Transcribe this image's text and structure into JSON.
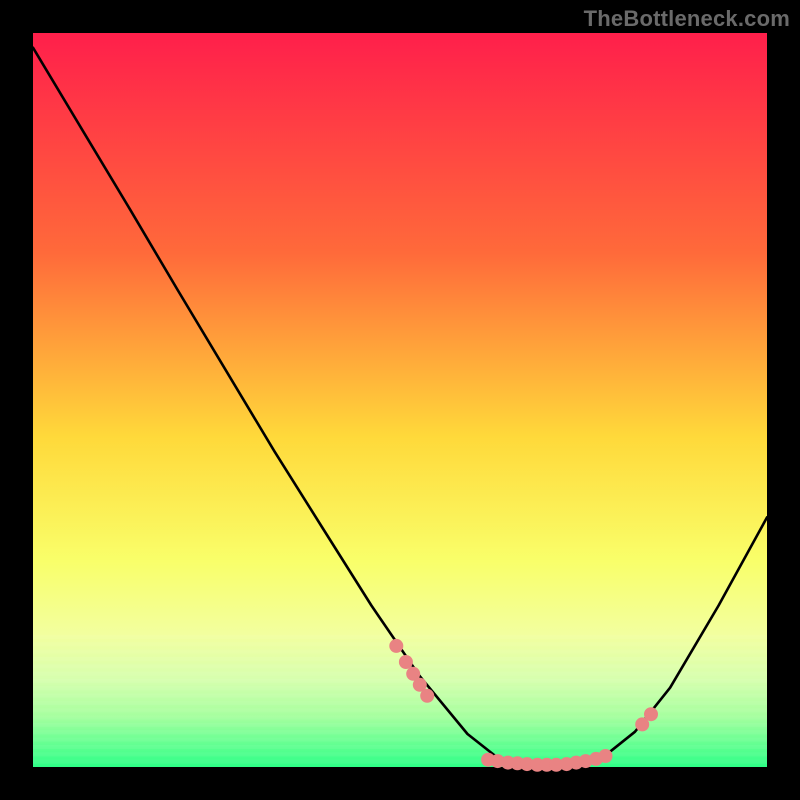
{
  "watermark": "TheBottleneck.com",
  "chart_data": {
    "type": "line",
    "title": "",
    "xlabel": "",
    "ylabel": "",
    "xlim": [
      0,
      100
    ],
    "ylim": [
      0,
      100
    ],
    "background_gradient": {
      "stops": [
        {
          "offset": 0.0,
          "color": "#ff1f4b"
        },
        {
          "offset": 0.3,
          "color": "#ff6a3a"
        },
        {
          "offset": 0.55,
          "color": "#ffd93a"
        },
        {
          "offset": 0.72,
          "color": "#f9ff6a"
        },
        {
          "offset": 0.82,
          "color": "#f2ff9f"
        },
        {
          "offset": 0.88,
          "color": "#d7ffae"
        },
        {
          "offset": 0.93,
          "color": "#a7ff9f"
        },
        {
          "offset": 1.0,
          "color": "#2eff87"
        }
      ]
    },
    "series": [
      {
        "name": "bottleneck-curve",
        "x": [
          0.0,
          6.6,
          13.2,
          19.7,
          26.3,
          32.9,
          39.5,
          46.1,
          52.6,
          59.2,
          63.0,
          66.0,
          70.0,
          74.0,
          78.0,
          82.0,
          86.8,
          93.4,
          100.0
        ],
        "y": [
          98.0,
          87.0,
          76.0,
          65.0,
          54.0,
          43.0,
          32.5,
          22.0,
          12.5,
          4.5,
          1.5,
          0.5,
          0.2,
          0.5,
          1.6,
          4.8,
          10.8,
          22.0,
          34.0
        ]
      }
    ],
    "markers": {
      "name": "highlight-points",
      "color": "#e98383",
      "points": [
        {
          "x": 49.5,
          "y": 16.5
        },
        {
          "x": 50.8,
          "y": 14.3
        },
        {
          "x": 51.8,
          "y": 12.7
        },
        {
          "x": 52.7,
          "y": 11.2
        },
        {
          "x": 53.7,
          "y": 9.7
        },
        {
          "x": 62.0,
          "y": 1.0
        },
        {
          "x": 63.3,
          "y": 0.8
        },
        {
          "x": 64.7,
          "y": 0.6
        },
        {
          "x": 66.0,
          "y": 0.5
        },
        {
          "x": 67.3,
          "y": 0.4
        },
        {
          "x": 68.7,
          "y": 0.3
        },
        {
          "x": 70.0,
          "y": 0.3
        },
        {
          "x": 71.3,
          "y": 0.3
        },
        {
          "x": 72.7,
          "y": 0.4
        },
        {
          "x": 74.0,
          "y": 0.6
        },
        {
          "x": 75.3,
          "y": 0.8
        },
        {
          "x": 76.7,
          "y": 1.1
        },
        {
          "x": 78.0,
          "y": 1.5
        },
        {
          "x": 83.0,
          "y": 5.8
        },
        {
          "x": 84.2,
          "y": 7.2
        }
      ]
    }
  }
}
